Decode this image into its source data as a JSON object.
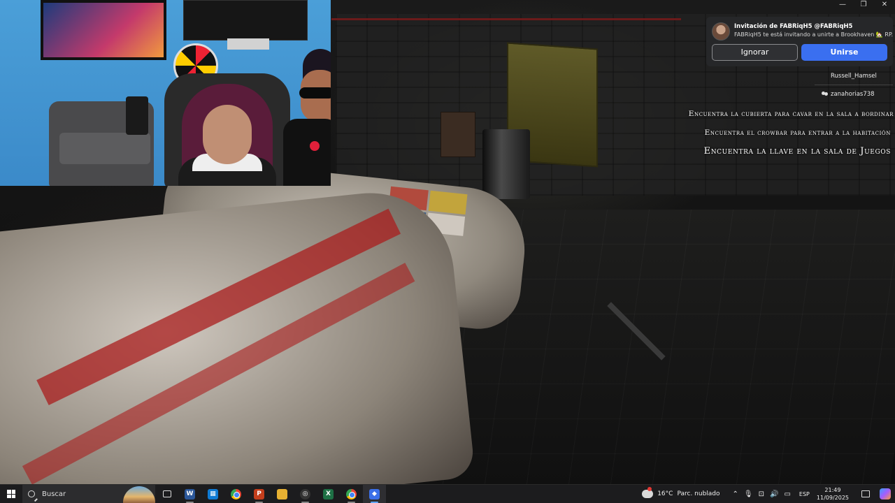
{
  "window_controls": {
    "minimize": "—",
    "restore": "❐",
    "close": "✕"
  },
  "invite": {
    "title": "Invitación de FABRiqH5 @FABRiqH5",
    "message": "FABRiqH5 te está invitando a unirte a Brookhaven 🏡 RP.",
    "ignore_label": "Ignorar",
    "join_label": "Unirse"
  },
  "players": [
    {
      "name": "Russell_Hamsel"
    },
    {
      "name": "zanahorias738",
      "friend": true
    }
  ],
  "objectives": [
    "Encuentra la cubierta para cavar en la sala a bordinar",
    "Encuentra el crowbar para entrar a la habitación",
    "Encuentra la llave en la sala de Juegos"
  ],
  "taskbar": {
    "search_placeholder": "Buscar",
    "apps": [
      {
        "icon": "task-view-icon"
      },
      {
        "icon": "word-icon",
        "glyph": "W",
        "color": "#2b579a"
      },
      {
        "icon": "microsoft-store-icon",
        "glyph": "▦",
        "color": "#0f7bd4"
      },
      {
        "icon": "chrome-icon"
      },
      {
        "icon": "powerpoint-icon",
        "glyph": "P",
        "color": "#c43e1c"
      },
      {
        "icon": "file-explorer-icon",
        "glyph": "▬",
        "color": "#e8b132"
      },
      {
        "icon": "obs-icon",
        "glyph": "◎",
        "color": "#333333"
      },
      {
        "icon": "excel-icon",
        "glyph": "X",
        "color": "#1e7145"
      },
      {
        "icon": "chrome-profile-icon"
      },
      {
        "icon": "roblox-icon",
        "glyph": "◆",
        "color": "#3b6fe8"
      }
    ],
    "weather": {
      "temperature": "16°C",
      "condition": "Parc. nublado"
    },
    "language": "ESP",
    "time": "21:49",
    "date": "11/09/2025"
  }
}
